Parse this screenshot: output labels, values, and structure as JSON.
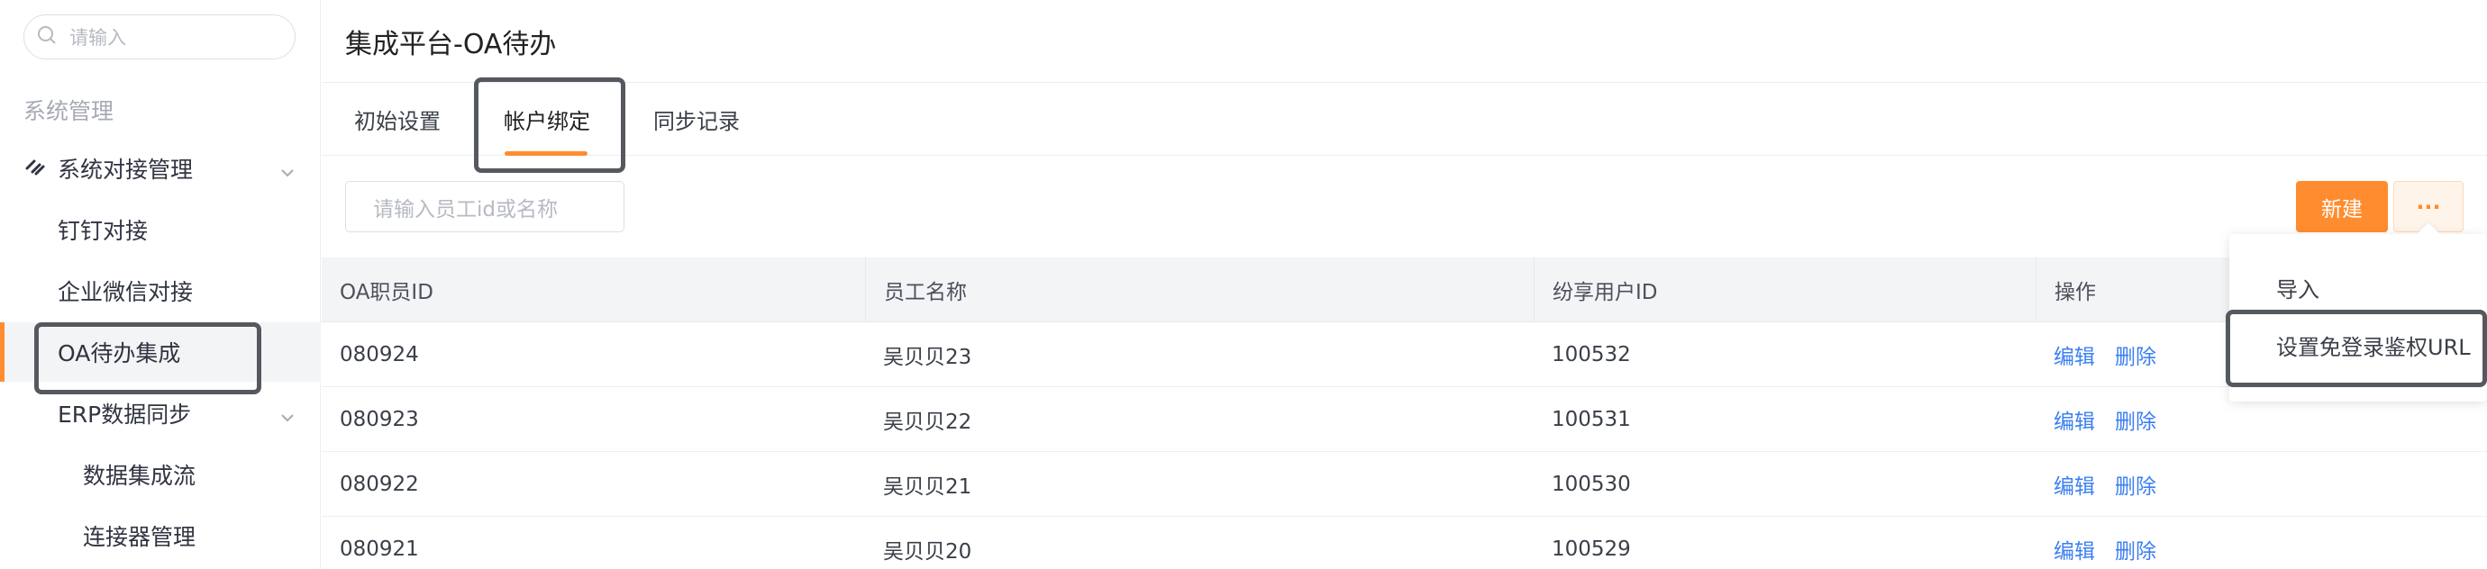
{
  "sidebar": {
    "search_placeholder": "请输入",
    "section_title": "系统管理",
    "items": [
      {
        "label": "系统对接管理"
      },
      {
        "label": "钉钉对接"
      },
      {
        "label": "企业微信对接"
      },
      {
        "label": "OA待办集成"
      },
      {
        "label": "ERP数据同步"
      },
      {
        "label": "数据集成流"
      },
      {
        "label": "连接器管理"
      }
    ]
  },
  "header": {
    "title": "集成平台-OA待办"
  },
  "tabs": [
    {
      "label": "初始设置"
    },
    {
      "label": "帐户绑定"
    },
    {
      "label": "同步记录"
    }
  ],
  "toolbar": {
    "search_placeholder": "请输入员工id或名称",
    "new_label": "新建",
    "more_label": "···"
  },
  "table": {
    "columns": [
      "OA职员ID",
      "员工名称",
      "纷享用户ID",
      "操作"
    ],
    "rows": [
      {
        "oa_id": "080924",
        "name": "吴贝贝23",
        "user_id": "100532"
      },
      {
        "oa_id": "080923",
        "name": "吴贝贝22",
        "user_id": "100531"
      },
      {
        "oa_id": "080922",
        "name": "吴贝贝21",
        "user_id": "100530"
      },
      {
        "oa_id": "080921",
        "name": "吴贝贝20",
        "user_id": "100529"
      }
    ],
    "edit_label": "编辑",
    "delete_label": "删除"
  },
  "dropdown": {
    "items": [
      {
        "label": "导入"
      },
      {
        "label": "设置免登录鉴权URL"
      }
    ]
  },
  "colors": {
    "accent": "#ff8c2f",
    "link": "#3b7ff0"
  }
}
